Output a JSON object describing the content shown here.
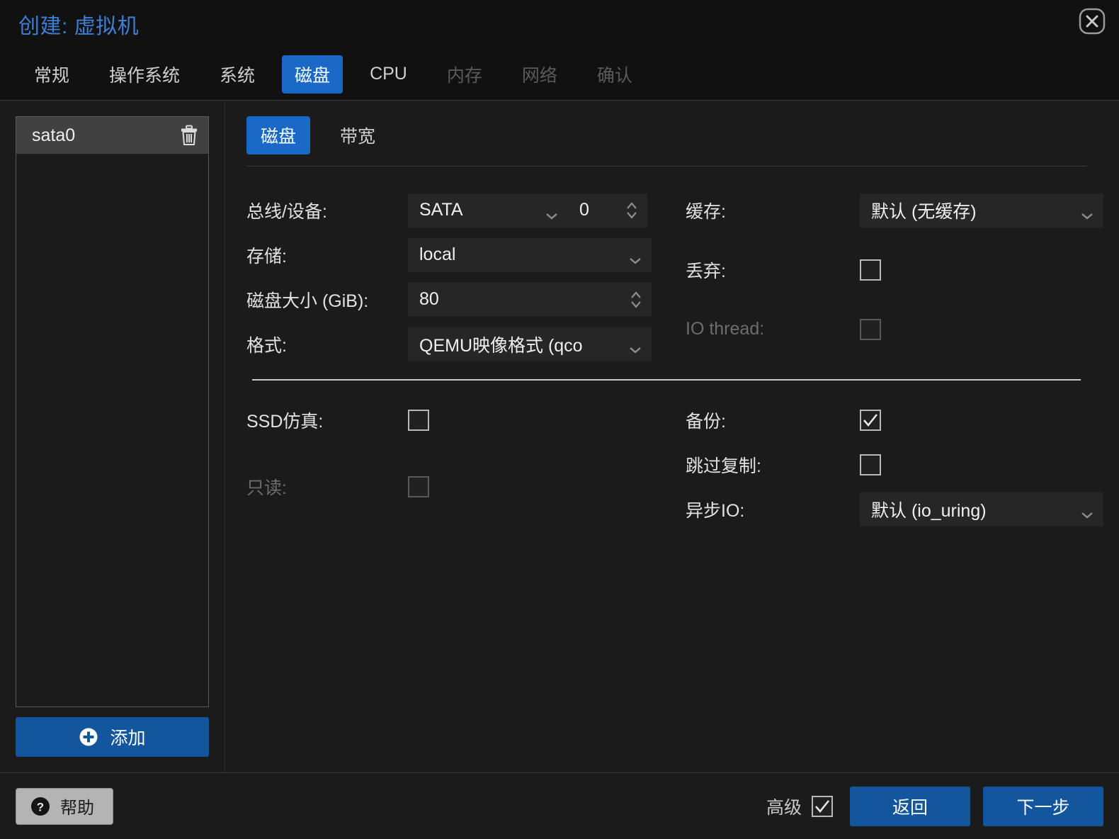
{
  "window": {
    "title": "创建: 虚拟机",
    "close_icon": "close-circle-icon"
  },
  "tabs": [
    {
      "label": "常规",
      "state": "normal"
    },
    {
      "label": "操作系统",
      "state": "normal"
    },
    {
      "label": "系统",
      "state": "normal"
    },
    {
      "label": "磁盘",
      "state": "active"
    },
    {
      "label": "CPU",
      "state": "normal"
    },
    {
      "label": "内存",
      "state": "disabled"
    },
    {
      "label": "网络",
      "state": "disabled"
    },
    {
      "label": "确认",
      "state": "disabled"
    }
  ],
  "sidebar": {
    "devices": [
      {
        "name": "sata0",
        "delete_icon": "trash-icon",
        "selected": true
      }
    ],
    "add_button": {
      "label": "添加",
      "icon": "plus-circle-icon"
    }
  },
  "subtabs": [
    {
      "label": "磁盘",
      "state": "active"
    },
    {
      "label": "带宽",
      "state": "normal"
    }
  ],
  "form": {
    "left": {
      "bus_device": {
        "label": "总线/设备:",
        "bus_value": "SATA",
        "index_value": "0"
      },
      "storage": {
        "label": "存储:",
        "value": "local"
      },
      "disk_size": {
        "label": "磁盘大小 (GiB):",
        "value": "80"
      },
      "format": {
        "label": "格式:",
        "value": "QEMU映像格式 (qco"
      }
    },
    "right": {
      "cache": {
        "label": "缓存:",
        "value": "默认 (无缓存)"
      },
      "discard": {
        "label": "丢弃:",
        "checked": false,
        "enabled": true
      },
      "io_thread": {
        "label": "IO thread:",
        "checked": false,
        "enabled": false
      }
    },
    "advanced_left": {
      "ssd_emulation": {
        "label": "SSD仿真:",
        "checked": false,
        "enabled": true
      },
      "read_only": {
        "label": "只读:",
        "checked": false,
        "enabled": false
      }
    },
    "advanced_right": {
      "backup": {
        "label": "备份:",
        "checked": true,
        "enabled": true
      },
      "skip_replication": {
        "label": "跳过复制:",
        "checked": false,
        "enabled": true
      },
      "async_io": {
        "label": "异步IO:",
        "value": "默认 (io_uring)"
      }
    }
  },
  "footer": {
    "help": {
      "label": "帮助",
      "icon": "question-circle-icon"
    },
    "advanced": {
      "label": "高级",
      "checked": true
    },
    "back": "返回",
    "next": "下一步"
  },
  "colors": {
    "accent": "#1a69c6",
    "button": "#14569e",
    "title": "#3c7fd4",
    "background": "#1b1b1b",
    "field": "#262626",
    "selected_row": "#414141"
  }
}
